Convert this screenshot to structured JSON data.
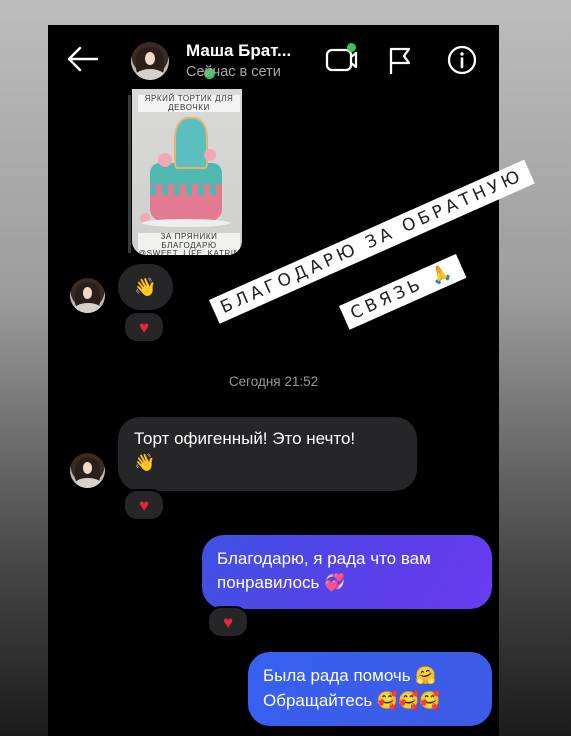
{
  "header": {
    "contact_name": "Маша Брат...",
    "contact_status": "Сейчас в сети",
    "icons": [
      "back-arrow-icon",
      "video-call-icon",
      "flag-icon",
      "info-icon"
    ]
  },
  "photo_message": {
    "caption_top": "ЯРКИЙ ТОРТИК ДЛЯ ДЕВОЧКИ",
    "caption_bottom": "ЗА ПРЯНИКИ БЛАГОДАРЮ @SWEET_LIFE_KATRIN"
  },
  "messages": {
    "wave_reaction_emoji": "👋",
    "date_separator": "Сегодня 21:52",
    "incoming_line1": "Торт офигенный! Это нечто!",
    "incoming_line2": "👋",
    "outgoing1_line1": "Благодарю, я рада что вам",
    "outgoing1_line2": "понравилось 💞",
    "outgoing2_line1": "Была рада помочь 🤗",
    "outgoing2_line2": "Обращайтесь 🥰🥰🥰",
    "heart": "♥"
  },
  "story_sticker": {
    "line1": "БЛАГОДАРЮ ЗА ОБРАТНУЮ",
    "line2": "СВЯЗЬ 🙏"
  },
  "colors": {
    "online": "#39c45b",
    "outgoing_bubble": "#3f52e4",
    "incoming_bubble": "#262628",
    "heart": "#e8263a"
  }
}
